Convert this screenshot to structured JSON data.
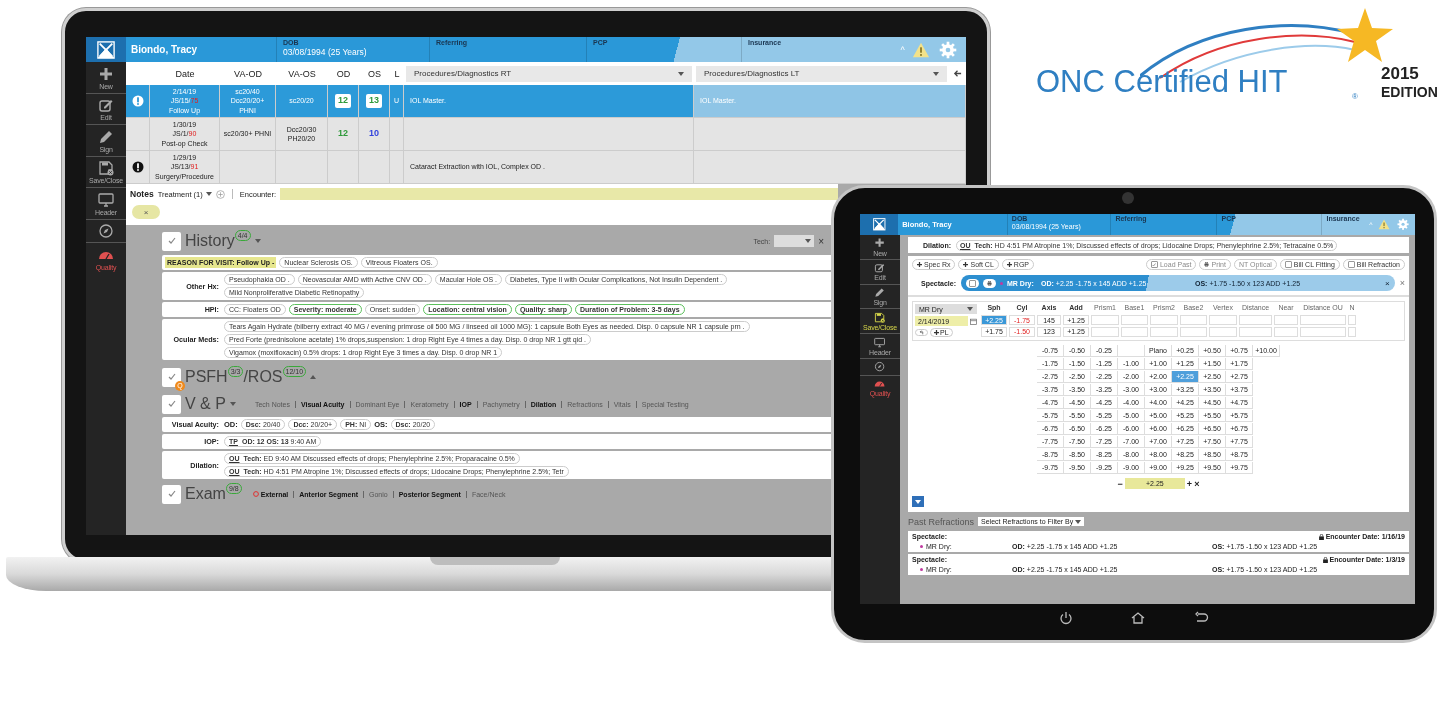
{
  "logo": {
    "title": "ONC Certified HIT",
    "registered": "®",
    "year": "2015",
    "edition": "EDITION"
  },
  "laptop": {
    "header": {
      "patient": "Biondo, Tracy",
      "dob_label": "DOB",
      "dob": "03/08/1994 (25 Years)",
      "referring_label": "Referring",
      "pcp_label": "PCP",
      "insurance_label": "Insurance",
      "collapse": "^"
    },
    "sidebar": [
      {
        "kind": "new",
        "label": "New",
        "active": false
      },
      {
        "kind": "edit",
        "label": "Edit",
        "active": false
      },
      {
        "kind": "sign",
        "label": "Sign",
        "active": false
      },
      {
        "kind": "save",
        "label": "Save/Close",
        "active": false
      },
      {
        "kind": "header",
        "label": "Header",
        "active": false
      },
      {
        "kind": "compass",
        "active": false
      },
      {
        "kind": "quality",
        "label": "Quality",
        "active": false
      }
    ],
    "encounters": {
      "columns": [
        "Date",
        "VA-OD",
        "VA-OS",
        "OD",
        "OS",
        "L"
      ],
      "rt_select": "Procedures/Diagnostics RT",
      "lt_select": "Procedures/Diagnostics LT",
      "rows": [
        {
          "selected": true,
          "kind": "info",
          "date": "2/14/19",
          "code": "JS/15/",
          "score": "75",
          "visit": "Follow Up",
          "va_od": [
            "sc20/40",
            "Dcc20/20+",
            "PHNI"
          ],
          "va_os": [
            "sc20/20"
          ],
          "od": {
            "text": "12",
            "color": "#2e9a3a"
          },
          "os": {
            "text": "13",
            "color": "#2e9a3a"
          },
          "l": "U",
          "rt": "IOL Master.",
          "lt": "IOL Master."
        },
        {
          "selected": false,
          "kind": "plain",
          "date": "1/30/19",
          "code": "JS/1/",
          "score": "90",
          "visit": "Post-op Check",
          "va_od": [
            "sc20/30+ PHNI"
          ],
          "va_os": [
            "Dcc20/30",
            "PH20/20"
          ],
          "od": {
            "text": "12",
            "color": "#2e9a3a"
          },
          "os": {
            "text": "10",
            "color": "#3344dd"
          }
        },
        {
          "selected": false,
          "kind": "warning",
          "date": "1/29/19",
          "code": "JS/13/",
          "score": "91",
          "visit": "Surgery/Procedure",
          "va_od": [],
          "va_os": [],
          "rt": "Cataract Extraction with IOL, Complex OD ."
        }
      ]
    },
    "notes": {
      "title": "Notes",
      "treatment": "Treatment (1)",
      "encounter_label": "Encounter:",
      "chip_close": "×"
    },
    "history": {
      "title": "History",
      "count": "4/4",
      "tech_label": "Tech:",
      "clear": "×",
      "reason": "REASON FOR VISIT: Follow Up -",
      "reason_chips": [
        "Nuclear Sclerosis OS.",
        "Vitreous Floaters OS."
      ],
      "rows": [
        {
          "label": "Other Hx:",
          "chips": [
            {
              "text": "Pseudophakia OD .",
              "highlighted": false
            },
            {
              "text": "Neovascular AMD with Active CNV OD .",
              "highlighted": false
            },
            {
              "text": "Macular Hole OS .",
              "highlighted": false
            },
            {
              "text": "Diabetes, Type II with Ocular Complications, Not Insulin Dependent .",
              "highlighted": false
            },
            {
              "text": "Mild Nonproliferative Diabetic Retinopathy",
              "highlighted": false
            }
          ]
        },
        {
          "label": "HPI:",
          "chips": [
            {
              "text": "CC: Floaters OD",
              "highlighted": false
            },
            {
              "text": "Severity: moderate",
              "highlighted": true
            },
            {
              "text": "Onset: sudden",
              "highlighted": false
            },
            {
              "text": "Location: central vision",
              "highlighted": true
            },
            {
              "text": "Quality: sharp",
              "highlighted": true
            },
            {
              "text": "Duration of Problem: 3-5 days",
              "highlighted": true
            }
          ]
        },
        {
          "label": "Ocular Meds:",
          "chips": [
            {
              "text": "Tears Again Hydrate (bilberry extract 40 MG / evening primrose oil 500 MG / linseed oil 1000 MG): 1 capsule Both Eyes as needed. Disp. 0 capsule NR 1 capsule prn .",
              "highlighted": false
            },
            {
              "text": "Pred Forte (prednisolone acetate) 1% drops,suspension: 1 drop Right Eye 4 times a day. Disp. 0 drop NR 1 gtt qid .",
              "highlighted": false
            },
            {
              "text": "Vigamox (moxifloxacin) 0.5% drops: 1 drop Right Eye 3 times a day. Disp. 0 drop NR 1",
              "highlighted": false
            }
          ]
        }
      ]
    },
    "psfh": {
      "title": "PSFH",
      "count": "3/3",
      "title_b": "/ROS",
      "count_b": "12/10",
      "badge": "Q"
    },
    "vp": {
      "title": "V & P",
      "tabs": [
        {
          "label": "Tech Notes",
          "filled": false
        },
        {
          "label": "Visual Acuity",
          "filled": true
        },
        {
          "label": "Dominant Eye",
          "filled": false
        },
        {
          "label": "Keratometry",
          "filled": false
        },
        {
          "label": "IOP",
          "filled": true
        },
        {
          "label": "Pachymetry",
          "filled": false
        },
        {
          "label": "Dilation",
          "filled": true
        },
        {
          "label": "Refractions",
          "filled": false
        },
        {
          "label": "Vitals",
          "filled": false
        },
        {
          "label": "Special Testing",
          "filled": false
        }
      ],
      "rows": [
        {
          "label": "Visual Acuity:",
          "items": [
            {
              "kind": "eye",
              "text": "**OD:**"
            },
            {
              "kind": "chip",
              "text": "**Dsc:** 20/40"
            },
            {
              "kind": "chip",
              "text": "**Dcc:** 20/20+"
            },
            {
              "kind": "chip",
              "text": "**PH:** NI"
            },
            {
              "kind": "eye",
              "text": "**OS:**"
            },
            {
              "kind": "chip",
              "text": "**Dsc:** 20/20"
            }
          ]
        },
        {
          "label": "IOP:",
          "items": [
            {
              "kind": "chip",
              "tag": "TP",
              "text": "**OD: 12  OS: 13**  9:40 AM"
            }
          ]
        },
        {
          "label": "Dilation:",
          "items": [
            {
              "kind": "chip",
              "tag": "OU",
              "text": "**Tech:** ED  9:40 AM  Discussed effects of drops; Phenylephrine 2.5%; Proparacaine 0.5%"
            },
            {
              "kind": "chip",
              "tag": "OU",
              "text": "**Tech:** HD  4:51 PM  Atropine 1%; Discussed effects of drops; Lidocaine Drops; Phenylephrine 2.5%; Tetr"
            }
          ]
        }
      ]
    },
    "exam": {
      "title": "Exam",
      "count": "9/8",
      "tabs": [
        {
          "label": "External",
          "filled": true,
          "flagged": true
        },
        {
          "label": "Anterior Segment",
          "filled": true,
          "flagged": false
        },
        {
          "label": "Gonio",
          "filled": false,
          "flagged": false
        },
        {
          "label": "Posterior Segment",
          "filled": true,
          "flagged": false
        },
        {
          "label": "Face/Neck",
          "filled": false,
          "flagged": false
        }
      ]
    }
  },
  "tablet": {
    "header": {
      "patient": "Biondo, Tracy",
      "dob_label": "DOB",
      "dob": "03/08/1994 (25 Years)",
      "referring_label": "Referring",
      "pcp_label": "PCP",
      "insurance_label": "Insurance",
      "collapse": "^"
    },
    "sidebar": [
      {
        "kind": "new",
        "label": "New",
        "active": false
      },
      {
        "kind": "edit",
        "label": "Edit",
        "active": false
      },
      {
        "kind": "sign",
        "label": "Sign",
        "active": false
      },
      {
        "kind": "save",
        "label": "Save/Close",
        "active": true
      },
      {
        "kind": "header",
        "label": "Header",
        "active": false
      },
      {
        "kind": "compass",
        "active": false
      },
      {
        "kind": "quality",
        "label": "Quality",
        "active": false
      }
    ],
    "dilation": {
      "label": "Dilation:",
      "tag": "OU",
      "text": "**Tech:** HD  4:51 PM  Atropine 1%; Discussed effects of drops; Lidocaine Drops; Phenylephrine 2.5%; Tetracaine 0.5%"
    },
    "add_buttons": [
      "Spec Rx",
      "Soft CL",
      "RGP"
    ],
    "options": [
      {
        "kind": "checkbox",
        "label": "Load Past",
        "checked": true,
        "disabled": true
      },
      {
        "kind": "print",
        "label": "Print",
        "disabled": true
      },
      {
        "kind": "plain",
        "label": "NT Optical",
        "disabled": true
      },
      {
        "kind": "checkbox",
        "label": "Bill CL Fitting",
        "checked": false,
        "disabled": false
      },
      {
        "kind": "checkbox",
        "label": "Bill Refraction",
        "checked": false,
        "disabled": false
      }
    ],
    "spectacle": {
      "label": "Spectacle:",
      "type": "MR Dry:",
      "od": "**OD:** +2.25 -1.75 x 145 ADD +1.25",
      "os": "**OS:** +1.75 -1.50 x 123 ADD +1.25",
      "close": "×",
      "remove": "×"
    },
    "rx": {
      "type": "MR Dry",
      "date": "2/14/2019",
      "pl": "PL",
      "columns": [
        {
          "label": "Sph",
          "warn": false
        },
        {
          "label": "Cyl",
          "warn": true
        },
        {
          "label": "Axis",
          "warn": false
        },
        {
          "label": "Add",
          "warn": false
        },
        {
          "label": "Prism1"
        },
        {
          "label": "Base1"
        },
        {
          "label": "Prism2"
        },
        {
          "label": "Base2"
        },
        {
          "label": "Vertex"
        },
        {
          "label": "Distance"
        },
        {
          "label": "Near"
        },
        {
          "label": "Distance OU"
        },
        {
          "label": "N"
        }
      ],
      "rows": [
        [
          {
            "v": "+2.25",
            "selected": true
          },
          {
            "v": "-1.75",
            "selected": false
          },
          {
            "v": "145",
            "selected": false
          },
          {
            "v": "+1.25",
            "selected": false
          }
        ],
        [
          {
            "v": "+1.75",
            "selected": false
          },
          {
            "v": "-1.50",
            "selected": false
          },
          {
            "v": "123",
            "selected": false
          },
          {
            "v": "+1.25",
            "selected": false
          }
        ]
      ]
    },
    "picker": {
      "rows": [
        [
          {
            "v": "-0.75",
            "selected": false
          },
          {
            "v": "-0.50",
            "selected": false
          },
          {
            "v": "-0.25",
            "selected": false
          },
          {
            "selected": false
          },
          {
            "v": "Plano",
            "selected": false
          },
          {
            "v": "+0.25",
            "selected": false
          },
          {
            "v": "+0.50",
            "selected": false
          },
          {
            "v": "+0.75",
            "selected": false
          },
          {
            "v": "+10.00",
            "selected": false
          }
        ],
        [
          {
            "v": "-1.75",
            "selected": false
          },
          {
            "v": "-1.50",
            "selected": false
          },
          {
            "v": "-1.25",
            "selected": false
          },
          {
            "v": "-1.00",
            "selected": false
          },
          {
            "v": "+1.00",
            "selected": false
          },
          {
            "v": "+1.25",
            "selected": false
          },
          {
            "v": "+1.50",
            "selected": false
          },
          {
            "v": "+1.75",
            "selected": false
          }
        ],
        [
          {
            "v": "-2.75",
            "selected": false
          },
          {
            "v": "-2.50",
            "selected": false
          },
          {
            "v": "-2.25",
            "selected": false
          },
          {
            "v": "-2.00",
            "selected": false
          },
          {
            "v": "+2.00",
            "selected": false
          },
          {
            "v": "+2.25",
            "selected": true
          },
          {
            "v": "+2.50",
            "selected": false
          },
          {
            "v": "+2.75",
            "selected": false
          }
        ],
        [
          {
            "v": "-3.75",
            "selected": false
          },
          {
            "v": "-3.50",
            "selected": false
          },
          {
            "v": "-3.25",
            "selected": false
          },
          {
            "v": "-3.00",
            "selected": false
          },
          {
            "v": "+3.00",
            "selected": false
          },
          {
            "v": "+3.25",
            "selected": false
          },
          {
            "v": "+3.50",
            "selected": false
          },
          {
            "v": "+3.75",
            "selected": false
          }
        ],
        [
          {
            "v": "-4.75",
            "selected": false
          },
          {
            "v": "-4.50",
            "selected": false
          },
          {
            "v": "-4.25",
            "selected": false
          },
          {
            "v": "-4.00",
            "selected": false
          },
          {
            "v": "+4.00",
            "selected": false
          },
          {
            "v": "+4.25",
            "selected": false
          },
          {
            "v": "+4.50",
            "selected": false
          },
          {
            "v": "+4.75",
            "selected": false
          }
        ],
        [
          {
            "v": "-5.75",
            "selected": false
          },
          {
            "v": "-5.50",
            "selected": false
          },
          {
            "v": "-5.25",
            "selected": false
          },
          {
            "v": "-5.00",
            "selected": false
          },
          {
            "v": "+5.00",
            "selected": false
          },
          {
            "v": "+5.25",
            "selected": false
          },
          {
            "v": "+5.50",
            "selected": false
          },
          {
            "v": "+5.75",
            "selected": false
          }
        ],
        [
          {
            "v": "-6.75",
            "selected": false
          },
          {
            "v": "-6.50",
            "selected": false
          },
          {
            "v": "-6.25",
            "selected": false
          },
          {
            "v": "-6.00",
            "selected": false
          },
          {
            "v": "+6.00",
            "selected": false
          },
          {
            "v": "+6.25",
            "selected": false
          },
          {
            "v": "+6.50",
            "selected": false
          },
          {
            "v": "+6.75",
            "selected": false
          }
        ],
        [
          {
            "v": "-7.75",
            "selected": false
          },
          {
            "v": "-7.50",
            "selected": false
          },
          {
            "v": "-7.25",
            "selected": false
          },
          {
            "v": "-7.00",
            "selected": false
          },
          {
            "v": "+7.00",
            "selected": false
          },
          {
            "v": "+7.25",
            "selected": false
          },
          {
            "v": "+7.50",
            "selected": false
          },
          {
            "v": "+7.75",
            "selected": false
          }
        ],
        [
          {
            "v": "-8.75",
            "selected": false
          },
          {
            "v": "-8.50",
            "selected": false
          },
          {
            "v": "-8.25",
            "selected": false
          },
          {
            "v": "-8.00",
            "selected": false
          },
          {
            "v": "+8.00",
            "selected": false
          },
          {
            "v": "+8.25",
            "selected": false
          },
          {
            "v": "+8.50",
            "selected": false
          },
          {
            "v": "+8.75",
            "selected": false
          }
        ],
        [
          {
            "v": "-9.75",
            "selected": false
          },
          {
            "v": "-9.50",
            "selected": false
          },
          {
            "v": "-9.25",
            "selected": false
          },
          {
            "v": "-9.00",
            "selected": false
          },
          {
            "v": "+9.00",
            "selected": false
          },
          {
            "v": "+9.25",
            "selected": false
          },
          {
            "v": "+9.50",
            "selected": false
          },
          {
            "v": "+9.75",
            "selected": false
          }
        ]
      ],
      "minus": "−",
      "value": "+2.25",
      "plus": "+",
      "clear": "×"
    },
    "past": {
      "title": "Past Refractions",
      "filter": "Select Refractions to Filter By",
      "entries": [
        {
          "label": "Spectacle:",
          "date": "Encounter Date: 1/16/19",
          "type": "MR Dry:",
          "od": "**OD:** +2.25 -1.75 x 145 ADD +1.25",
          "os": "**OS:** +1.75 -1.50 x 123 ADD +1.25"
        },
        {
          "label": "Spectacle:",
          "date": "Encounter Date: 1/3/19",
          "type": "MR Dry:",
          "od": "**OD:** +2.25 -1.75 x 145 ADD +1.25",
          "os": "**OS:** +1.75 -1.50 x 123 ADD +1.25"
        }
      ]
    }
  }
}
